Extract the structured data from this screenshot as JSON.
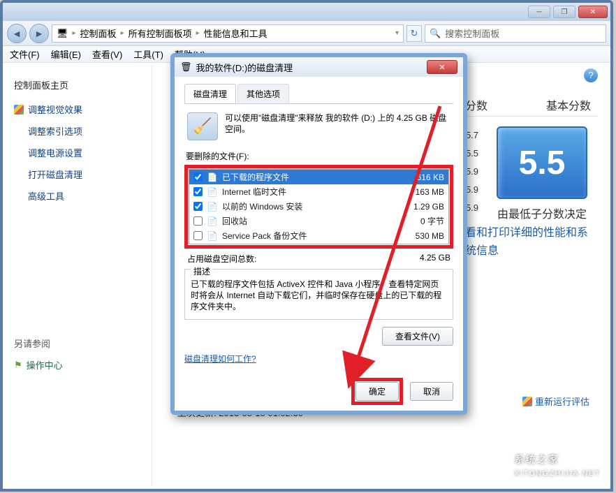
{
  "window": {
    "breadcrumb": [
      "控制面板",
      "所有控制面板项",
      "性能信息和工具"
    ],
    "search_placeholder": "搜索控制面板"
  },
  "menu": [
    "文件(F)",
    "编辑(E)",
    "查看(V)",
    "工具(T)",
    "帮助(H)"
  ],
  "sidebar": {
    "header": "控制面板主页",
    "items": [
      {
        "label": "调整视觉效果",
        "shield": true
      },
      {
        "label": "调整索引选项",
        "shield": false
      },
      {
        "label": "调整电源设置",
        "shield": false
      },
      {
        "label": "打开磁盘清理",
        "shield": false
      },
      {
        "label": "高级工具",
        "shield": false
      }
    ],
    "see_also": "另请参阅",
    "action_center": "操作中心"
  },
  "main": {
    "last_update_label": "上次更新:",
    "last_update_value": "2013-08-18 01:02:30",
    "score_sub": "分数",
    "score_base": "基本分数",
    "score_value": "5.5",
    "score_caption": "由最低子分数决定",
    "scores_col": [
      "5.7",
      "5.5",
      "5.9",
      "5.9",
      "5.9"
    ],
    "link_detail": "看和打印详细的性能和系统信息",
    "rerun_label": "重新运行评估"
  },
  "dialog": {
    "title": "我的软件(D:)的磁盘清理",
    "tab_cleanup": "磁盘清理",
    "tab_other": "其他选项",
    "intro": "可以使用\"磁盘清理\"来释放 我的软件 (D:) 上的 4.25 GB 磁盘空间。",
    "files_label": "要删除的文件(F):",
    "files": [
      {
        "name": "已下载的程序文件",
        "size": "616 KB",
        "checked": true,
        "selected": true
      },
      {
        "name": "Internet 临时文件",
        "size": "163 MB",
        "checked": true,
        "selected": false
      },
      {
        "name": "以前的 Windows 安装",
        "size": "1.29 GB",
        "checked": true,
        "selected": false
      },
      {
        "name": "回收站",
        "size": "0 字节",
        "checked": false,
        "selected": false
      },
      {
        "name": "Service Pack 备份文件",
        "size": "530 MB",
        "checked": false,
        "selected": false
      }
    ],
    "total_label": "占用磁盘空间总数:",
    "total_value": "4.25 GB",
    "desc_legend": "描述",
    "desc_text": "已下载的程序文件包括 ActiveX 控件和 Java 小程序，查看特定网页时将会从 Internet 自动下载它们，并临时保存在硬盘上的已下载的程序文件夹中。",
    "view_files": "查看文件(V)",
    "how_link": "磁盘清理如何工作?",
    "ok": "确定",
    "cancel": "取消"
  }
}
